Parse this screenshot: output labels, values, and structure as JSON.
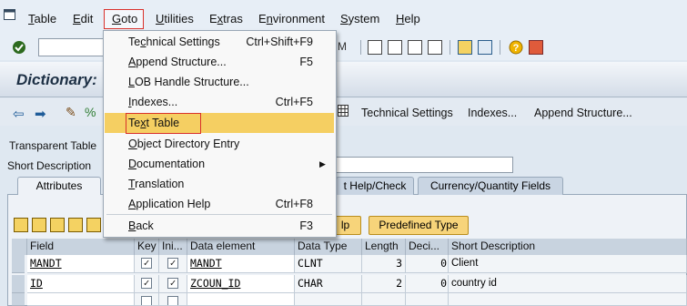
{
  "menubar": {
    "items": [
      "Table",
      "Edit",
      "Goto",
      "Utilities",
      "Extras",
      "Environment",
      "System",
      "Help"
    ],
    "mnemonic": [
      "T",
      "E",
      "G",
      "U",
      "x",
      "n",
      "S",
      "H"
    ],
    "rest": [
      "able",
      "dit",
      "oto",
      "tilities",
      "tras",
      "vironment",
      "ystem",
      "elp"
    ],
    "pre": [
      "",
      "",
      "",
      "",
      "E",
      "E",
      "",
      ""
    ]
  },
  "title": "Dictionary:",
  "app_toolbar": {
    "technical_settings": "Technical Settings",
    "indexes": "Indexes...",
    "append_structure": "Append Structure..."
  },
  "fields": {
    "transparent_table_label": "Transparent Table",
    "short_description_label": "Short Description",
    "short_description_value": ""
  },
  "tabs": [
    "Attributes",
    "t Help/Check",
    "Currency/Quantity Fields"
  ],
  "buttons": {
    "search_help": "lp",
    "predefined_type": "Predefined Type"
  },
  "table": {
    "headers": [
      "Field",
      "Key",
      "Ini...",
      "Data element",
      "Data Type",
      "Length",
      "Deci...",
      "Short Description"
    ],
    "rows": [
      {
        "field": "MANDT",
        "key": true,
        "ini": true,
        "element": "MANDT",
        "type": "CLNT",
        "length": "3",
        "deci": "0",
        "desc": "Client"
      },
      {
        "field": "ID",
        "key": true,
        "ini": true,
        "element": "ZCOUN_ID",
        "type": "CHAR",
        "length": "2",
        "deci": "0",
        "desc": "country id"
      },
      {
        "field": "",
        "key": false,
        "ini": false,
        "element": "",
        "type": "",
        "length": "",
        "deci": "",
        "desc": ""
      }
    ]
  },
  "goto_menu": {
    "items": [
      {
        "label_pre": "Te",
        "mn": "c",
        "label_post": "hnical Settings",
        "shortcut": "Ctrl+Shift+F9"
      },
      {
        "label_pre": "",
        "mn": "A",
        "label_post": "ppend Structure...",
        "shortcut": "F5"
      },
      {
        "label_pre": "",
        "mn": "L",
        "label_post": "OB Handle Structure...",
        "shortcut": ""
      },
      {
        "label_pre": "",
        "mn": "I",
        "label_post": "ndexes...",
        "shortcut": "Ctrl+F5"
      },
      {
        "label_pre": "Te",
        "mn": "x",
        "label_post": "t Table",
        "shortcut": ""
      },
      {
        "label_pre": "",
        "mn": "O",
        "label_post": "bject Directory Entry",
        "shortcut": ""
      },
      {
        "label_pre": "",
        "mn": "D",
        "label_post": "ocumentation",
        "shortcut": ""
      },
      {
        "label_pre": "",
        "mn": "T",
        "label_post": "ranslation",
        "shortcut": ""
      },
      {
        "label_pre": "",
        "mn": "A",
        "label_post": "pplication Help",
        "shortcut": "Ctrl+F8"
      },
      {
        "label_pre": "",
        "mn": "B",
        "label_post": "ack",
        "shortcut": "F3"
      }
    ],
    "submenu_arrow": "▶"
  },
  "colors": {
    "highlight": "#f5cf62",
    "red_box": "#d9312b",
    "button_yellow": "#f7d47a"
  }
}
